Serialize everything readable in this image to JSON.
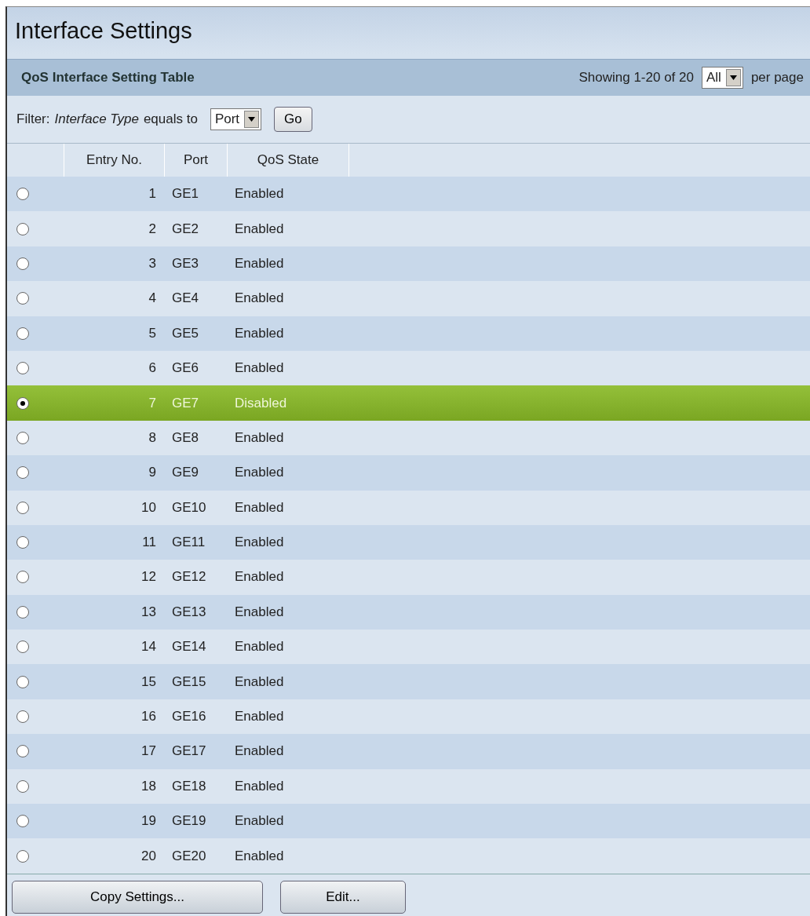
{
  "page_title": "Interface Settings",
  "table": {
    "title": "QoS Interface Setting Table",
    "showing": "Showing 1-20 of 20",
    "per_page_value": "All",
    "per_page_label": "per page",
    "filter": {
      "label": "Filter:",
      "field": "Interface Type",
      "operator": "equals to",
      "value": "Port",
      "go": "Go"
    },
    "columns": [
      "Entry No.",
      "Port",
      "QoS State"
    ],
    "rows": [
      {
        "entry": "1",
        "port": "GE1",
        "state": "Enabled",
        "selected": false
      },
      {
        "entry": "2",
        "port": "GE2",
        "state": "Enabled",
        "selected": false
      },
      {
        "entry": "3",
        "port": "GE3",
        "state": "Enabled",
        "selected": false
      },
      {
        "entry": "4",
        "port": "GE4",
        "state": "Enabled",
        "selected": false
      },
      {
        "entry": "5",
        "port": "GE5",
        "state": "Enabled",
        "selected": false
      },
      {
        "entry": "6",
        "port": "GE6",
        "state": "Enabled",
        "selected": false
      },
      {
        "entry": "7",
        "port": "GE7",
        "state": "Disabled",
        "selected": true
      },
      {
        "entry": "8",
        "port": "GE8",
        "state": "Enabled",
        "selected": false
      },
      {
        "entry": "9",
        "port": "GE9",
        "state": "Enabled",
        "selected": false
      },
      {
        "entry": "10",
        "port": "GE10",
        "state": "Enabled",
        "selected": false
      },
      {
        "entry": "11",
        "port": "GE11",
        "state": "Enabled",
        "selected": false
      },
      {
        "entry": "12",
        "port": "GE12",
        "state": "Enabled",
        "selected": false
      },
      {
        "entry": "13",
        "port": "GE13",
        "state": "Enabled",
        "selected": false
      },
      {
        "entry": "14",
        "port": "GE14",
        "state": "Enabled",
        "selected": false
      },
      {
        "entry": "15",
        "port": "GE15",
        "state": "Enabled",
        "selected": false
      },
      {
        "entry": "16",
        "port": "GE16",
        "state": "Enabled",
        "selected": false
      },
      {
        "entry": "17",
        "port": "GE17",
        "state": "Enabled",
        "selected": false
      },
      {
        "entry": "18",
        "port": "GE18",
        "state": "Enabled",
        "selected": false
      },
      {
        "entry": "19",
        "port": "GE19",
        "state": "Enabled",
        "selected": false
      },
      {
        "entry": "20",
        "port": "GE20",
        "state": "Enabled",
        "selected": false
      }
    ],
    "buttons": [
      "Copy Settings...",
      "Edit..."
    ]
  }
}
